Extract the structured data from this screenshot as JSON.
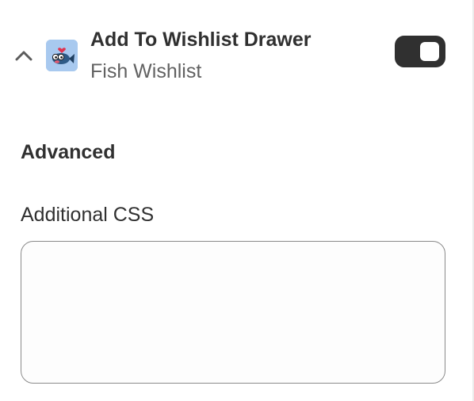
{
  "block": {
    "title": "Add To Wishlist Drawer",
    "subtitle": "Fish Wishlist",
    "collapse_icon": "chevron-up-icon",
    "app_icon": "fish-heart-icon",
    "enabled": true
  },
  "advanced": {
    "heading": "Advanced",
    "additional_css": {
      "label": "Additional CSS",
      "value": "",
      "placeholder": ""
    }
  },
  "colors": {
    "toggle_on": "#303030",
    "app_icon_bg": "#a8c9ef",
    "text_primary": "#303030",
    "text_secondary": "#616161"
  }
}
